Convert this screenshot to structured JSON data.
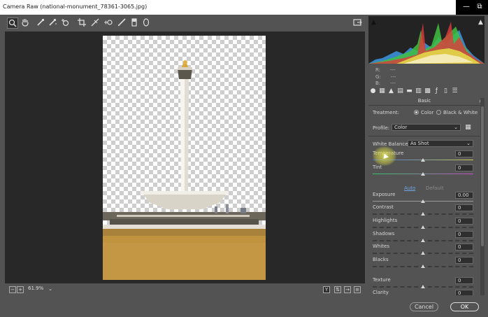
{
  "window": {
    "title": "Camera Raw (national-monument_78361-3065.jpg)",
    "minimize_glyph": "—",
    "restore_glyph": "⧉"
  },
  "toolbar": {
    "tools": [
      {
        "name": "zoom-tool-icon",
        "glyph": "🔍"
      },
      {
        "name": "hand-tool-icon",
        "glyph": "✋"
      },
      {
        "name": "white-balance-tool-icon",
        "glyph": "✒"
      },
      {
        "name": "color-sampler-tool-icon",
        "glyph": "✒"
      },
      {
        "name": "targeted-adjustment-tool-icon",
        "glyph": "⊕"
      },
      {
        "name": "crop-tool-icon",
        "glyph": "⌗"
      },
      {
        "name": "straighten-tool-icon",
        "glyph": "⟋"
      },
      {
        "name": "spot-removal-tool-icon",
        "glyph": "⊸"
      },
      {
        "name": "adjustment-brush-icon",
        "glyph": "🖌"
      },
      {
        "name": "graduated-filter-icon",
        "glyph": "▮"
      },
      {
        "name": "radial-filter-icon",
        "glyph": "◯"
      }
    ],
    "export_glyph": "⇱"
  },
  "histogram": {
    "r": "R:",
    "g": "G:",
    "b": "B:",
    "dash": "---"
  },
  "basic": {
    "title": "Basic",
    "treatment_label": "Treatment:",
    "treatment_color": "Color",
    "treatment_bw": "Black & White",
    "profile_label": "Profile:",
    "profile_value": "Color",
    "wb_label": "White Balance:",
    "wb_value": "As Shot",
    "auto_label": "Auto",
    "default_label": "Default"
  },
  "sliders": [
    {
      "key": "temperature",
      "label": "Temperature",
      "value": "0",
      "position": 0.5
    },
    {
      "key": "tint",
      "label": "Tint",
      "value": "0",
      "position": 0.5
    },
    {
      "key": "exposure",
      "label": "Exposure",
      "value": "0.00",
      "position": 0.5
    },
    {
      "key": "contrast",
      "label": "Contrast",
      "value": "0",
      "position": 0.5
    },
    {
      "key": "highlights",
      "label": "Highlights",
      "value": "0",
      "position": 0.5
    },
    {
      "key": "shadows",
      "label": "Shadows",
      "value": "0",
      "position": 0.5
    },
    {
      "key": "whites",
      "label": "Whites",
      "value": "0",
      "position": 0.5
    },
    {
      "key": "blacks",
      "label": "Blacks",
      "value": "0",
      "position": 0.5
    },
    {
      "key": "texture",
      "label": "Texture",
      "value": "0",
      "position": 0.5
    },
    {
      "key": "clarity",
      "label": "Clarity",
      "value": "0",
      "position": 0.5
    }
  ],
  "status": {
    "zoom": "61.9%"
  },
  "buttons": {
    "cancel": "Cancel",
    "ok": "OK"
  },
  "colors": {
    "accent_link": "#6fa8e8",
    "panel_bg": "#535353",
    "canvas_bg": "#282828"
  }
}
